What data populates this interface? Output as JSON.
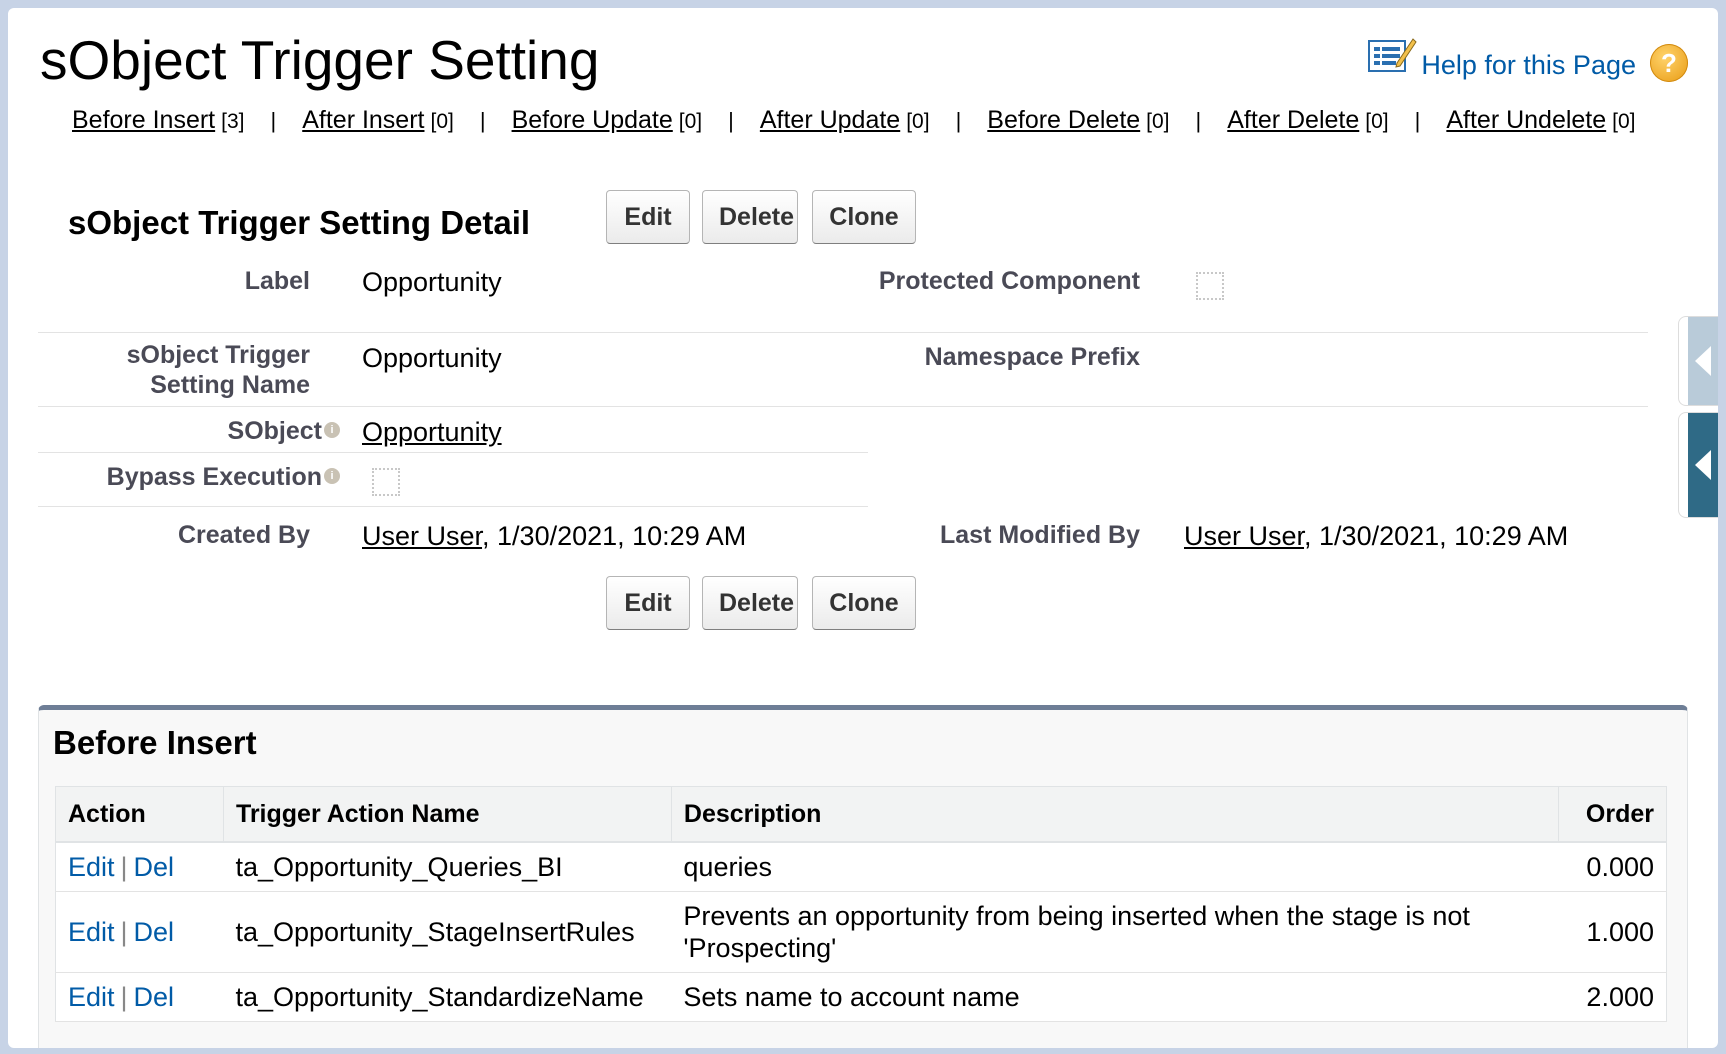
{
  "page": {
    "title": "sObject Trigger Setting",
    "help_label": "Help for this Page",
    "help_q": "?"
  },
  "related_nav": [
    {
      "label": "Before Insert",
      "count": "[3]"
    },
    {
      "label": "After Insert",
      "count": "[0]"
    },
    {
      "label": "Before Update",
      "count": "[0]"
    },
    {
      "label": "After Update",
      "count": "[0]"
    },
    {
      "label": "Before Delete",
      "count": "[0]"
    },
    {
      "label": "After Delete",
      "count": "[0]"
    },
    {
      "label": "After Undelete",
      "count": "[0]"
    }
  ],
  "nav_separator": "|",
  "detail": {
    "title": "sObject Trigger Setting Detail",
    "buttons": {
      "edit": "Edit",
      "delete": "Delete",
      "clone": "Clone"
    },
    "fields": {
      "label_label": "Label",
      "label_value": "Opportunity",
      "protected_label": "Protected Component",
      "protected_checked": false,
      "setting_name_label": "sObject Trigger Setting Name",
      "setting_name_value": "Opportunity",
      "namespace_label": "Namespace Prefix",
      "namespace_value": "",
      "sobject_label": "SObject",
      "sobject_value": "Opportunity",
      "bypass_label": "Bypass Execution",
      "bypass_checked": false,
      "created_by_label": "Created By",
      "created_by_user": "User User",
      "created_by_date": ", 1/30/2021, 10:29 AM",
      "modified_by_label": "Last Modified By",
      "modified_by_user": "User User",
      "modified_by_date": ", 1/30/2021, 10:29 AM"
    }
  },
  "related_list": {
    "title": "Before Insert",
    "columns": [
      "Action",
      "Trigger Action Name",
      "Description",
      "Order"
    ],
    "action_edit": "Edit",
    "action_del": "Del",
    "action_sep": "|",
    "rows": [
      {
        "name": "ta_Opportunity_Queries_BI",
        "description": "queries",
        "order": "0.000"
      },
      {
        "name": "ta_Opportunity_StageInsertRules",
        "description": "Prevents an opportunity from being inserted when the stage is not 'Prospecting'",
        "order": "1.000"
      },
      {
        "name": "ta_Opportunity_StandardizeName",
        "description": "Sets name to account name",
        "order": "2.000"
      }
    ]
  },
  "colors": {
    "link_blue": "#015ba7",
    "side_tab_light": "#b9cbd9",
    "side_tab_dark": "#2f6a86",
    "related_border": "#6e7e96"
  }
}
